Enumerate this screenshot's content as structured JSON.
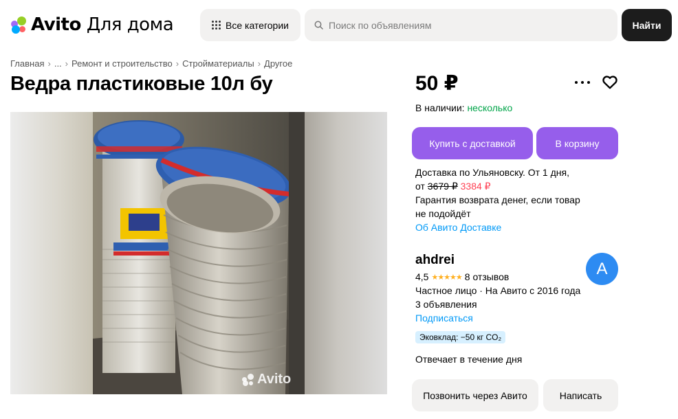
{
  "header": {
    "logo_text": "Avito",
    "logo_sub": "Для дома",
    "categories_label": "Все категории",
    "search_placeholder": "Поиск по объявлениям",
    "find_label": "Найти"
  },
  "breadcrumb": [
    "Главная",
    "...",
    "Ремонт и строительство",
    "Стройматериалы",
    "Другое"
  ],
  "listing": {
    "title": "Ведра пластиковые 10л бу",
    "photo_watermark": "Avito",
    "price": "50 ₽",
    "stock_label": "В наличии:",
    "stock_value": "несколько",
    "buy_label": "Купить с доставкой",
    "cart_label": "В корзину",
    "delivery_line1": "Доставка по Ульяновску. От 1 дня,",
    "delivery_from": "от",
    "delivery_old_price": "3679 ₽",
    "delivery_new_price": "3384 ₽",
    "guarantee_line1": "Гарантия возврата денег, если товар",
    "guarantee_line2": "не подойдёт",
    "about_delivery": "Об Авито Доставке"
  },
  "seller": {
    "name": "ahdrei",
    "rating": "4,5",
    "stars": "★★★★★",
    "reviews": "8 отзывов",
    "type_line": "Частное лицо · На Авито с 2016 года",
    "ads_count": "3 объявления",
    "subscribe": "Подписаться",
    "avatar_letter": "A",
    "eco": "Эковклад: −50 кг CO₂",
    "reply_time": "Отвечает в течение дня",
    "call_label": "Позвонить через Авито",
    "write_label": "Написать"
  },
  "colors": {
    "purple": "#965eeb",
    "green": "#02a54a",
    "link": "#0099f7",
    "avatar": "#2d8bf2",
    "sale": "#ff4053"
  }
}
